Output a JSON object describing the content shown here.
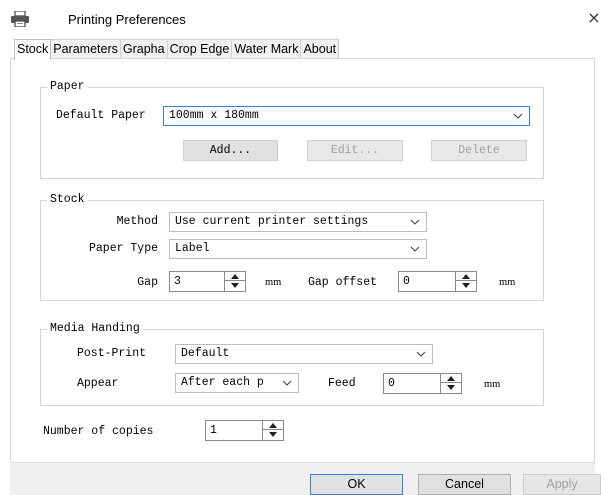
{
  "window": {
    "title": "Printing Preferences",
    "close_glyph": "×",
    "icon": "printer-icon"
  },
  "tabs": [
    {
      "label": "Stock",
      "active": true
    },
    {
      "label": "Parameters",
      "active": false
    },
    {
      "label": "Grapha",
      "active": false
    },
    {
      "label": "Crop Edge",
      "active": false
    },
    {
      "label": "Water Mark",
      "active": false
    },
    {
      "label": "About",
      "active": false
    }
  ],
  "paper": {
    "group_label": "Paper",
    "default_paper_label": "Default Paper",
    "default_paper_value": "100mm x 180mm",
    "add_label": "Add...",
    "edit_label": "Edit...",
    "delete_label": "Delete"
  },
  "stock": {
    "group_label": "Stock",
    "method_label": "Method",
    "method_value": "Use current printer settings",
    "paper_type_label": "Paper Type",
    "paper_type_value": "Label",
    "gap_label": "Gap",
    "gap_value": "3",
    "gap_unit": "mm",
    "gap_offset_label": "Gap offset",
    "gap_offset_value": "0",
    "gap_offset_unit": "mm"
  },
  "media": {
    "group_label": "Media Handing",
    "post_print_label": "Post-Print",
    "post_print_value": "Default",
    "appear_label": "Appear",
    "appear_value": "After each p",
    "feed_label": "Feed",
    "feed_value": "0",
    "feed_unit": "mm"
  },
  "copies": {
    "label": "Number of copies",
    "value": "1"
  },
  "footer": {
    "ok_label": "OK",
    "cancel_label": "Cancel",
    "apply_label": "Apply"
  },
  "colors": {
    "focus_border": "#3c7fd8",
    "disabled_text": "#a0a0a0",
    "footer_bg": "#f0f0f0"
  }
}
